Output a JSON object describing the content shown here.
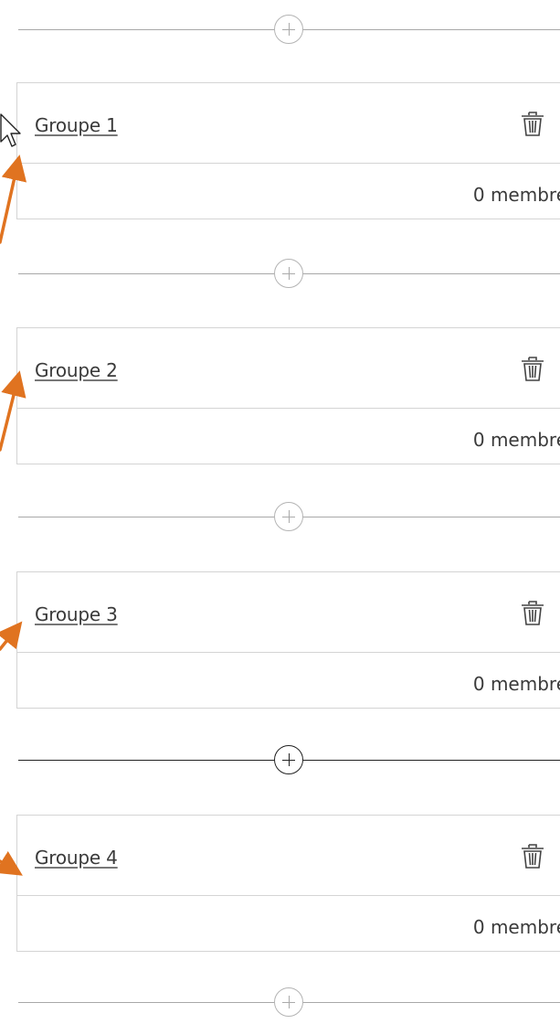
{
  "groups": [
    {
      "name": "Groupe 1",
      "members": "0 membre"
    },
    {
      "name": "Groupe 2",
      "members": "0 membre"
    },
    {
      "name": "Groupe 3",
      "members": "0 membre"
    },
    {
      "name": "Groupe 4",
      "members": "0 membre"
    }
  ],
  "annotation_color": "#e07320",
  "icons": {
    "add": "circled-plus-icon",
    "delete": "trash-icon",
    "pointer": "mouse-cursor-icon"
  }
}
